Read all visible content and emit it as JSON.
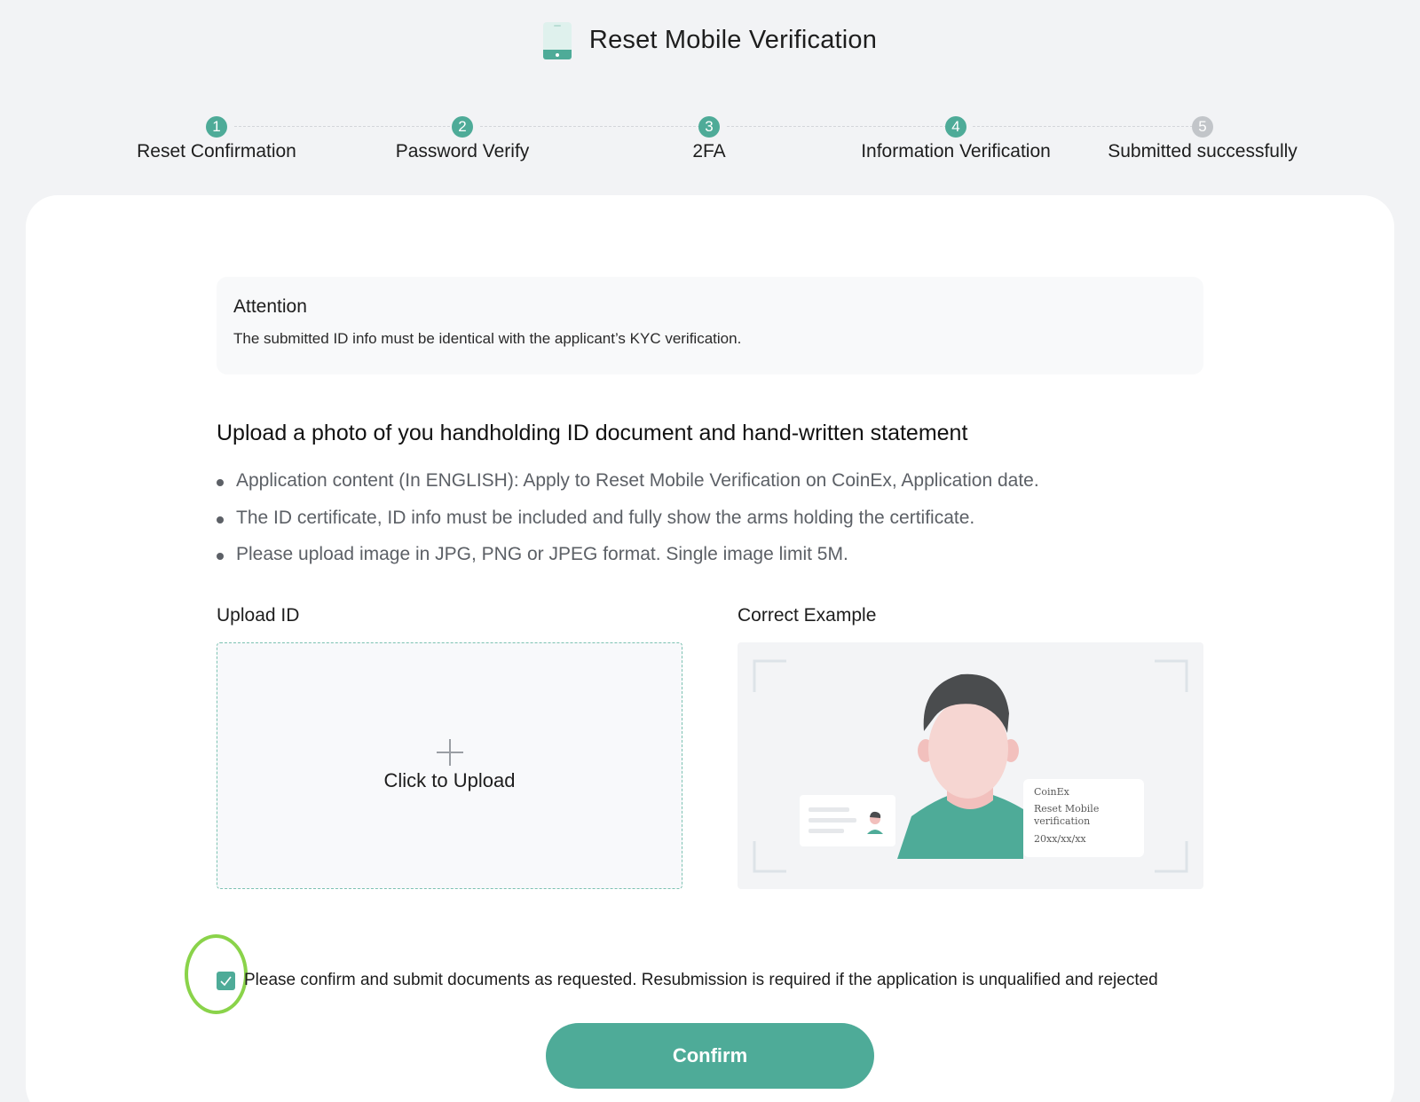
{
  "header": {
    "icon": "phone-icon",
    "title": "Reset Mobile Verification"
  },
  "steps": [
    {
      "number": "1",
      "label": "Reset Confirmation",
      "state": "done"
    },
    {
      "number": "2",
      "label": "Password Verify",
      "state": "done"
    },
    {
      "number": "3",
      "label": "2FA",
      "state": "done"
    },
    {
      "number": "4",
      "label": "Information Verification",
      "state": "current"
    },
    {
      "number": "5",
      "label": "Submitted successfully",
      "state": "pending"
    }
  ],
  "attention": {
    "title": "Attention",
    "text": "The submitted ID info must be identical with the applicant’s KYC verification."
  },
  "upload_section": {
    "heading": "Upload a photo of you handholding ID document and hand-written statement",
    "requirements": [
      "Application content (In ENGLISH): Apply to Reset Mobile Verification on CoinEx, Application date.",
      "The ID certificate, ID info must be included and fully show the arms holding the certificate.",
      "Please upload image in JPG, PNG or JPEG format. Single image limit 5M."
    ],
    "upload_label": "Upload ID",
    "upload_button_text": "Click to Upload",
    "example_label": "Correct Example",
    "example_note": {
      "brand": "CoinEx",
      "line1": "Reset Mobile",
      "line2": "verification",
      "date": "20xx/xx/xx"
    }
  },
  "agreement": {
    "checked": true,
    "text": "Please confirm and submit documents as requested. Resubmission is required if the application is unqualified and rejected"
  },
  "confirm_button": "Confirm",
  "colors": {
    "accent": "#4eab98",
    "pending_step": "#c2c5c9",
    "highlight_ring": "#8ad34a"
  }
}
